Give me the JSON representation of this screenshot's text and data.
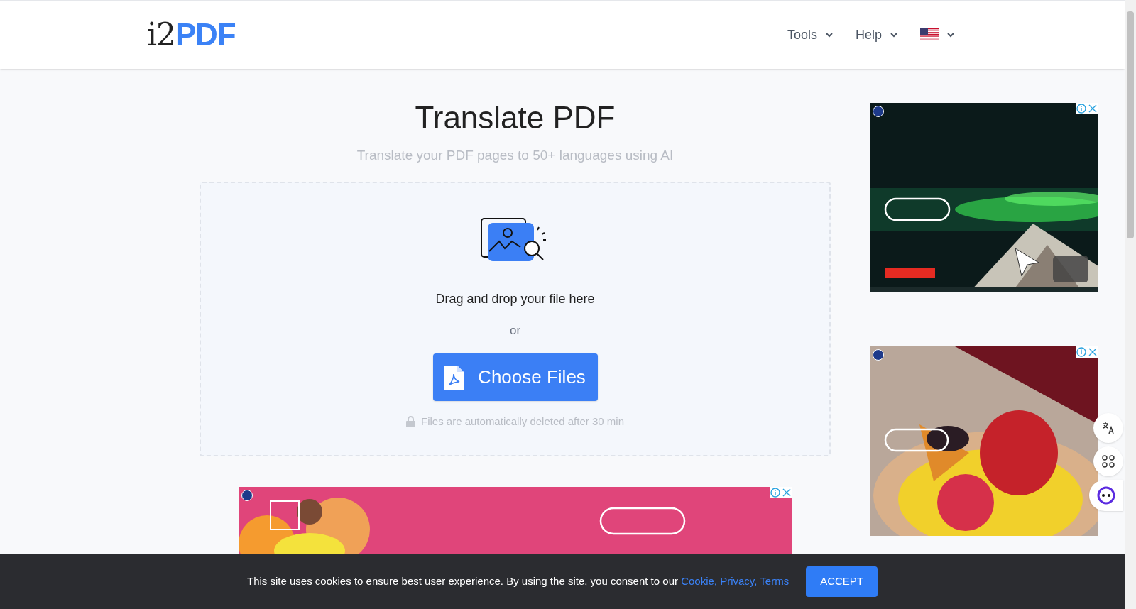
{
  "header": {
    "logo": {
      "prefix": "i2",
      "suffix": "PDF"
    },
    "nav": [
      {
        "label": "Tools"
      },
      {
        "label": "Help"
      }
    ]
  },
  "main": {
    "title": "Translate PDF",
    "subtitle": "Translate your PDF pages to 50+ languages using AI",
    "dropzone": {
      "prompt": "Drag and drop your file here",
      "separator": "or",
      "button": "Choose Files",
      "note": "Files are automatically deleted after 30 min"
    }
  },
  "cookie_bar": {
    "text": "This site uses cookies to ensure best user experience. By using the site, you consent to our",
    "link": "Cookie, Privacy, Terms",
    "button": "ACCEPT"
  }
}
